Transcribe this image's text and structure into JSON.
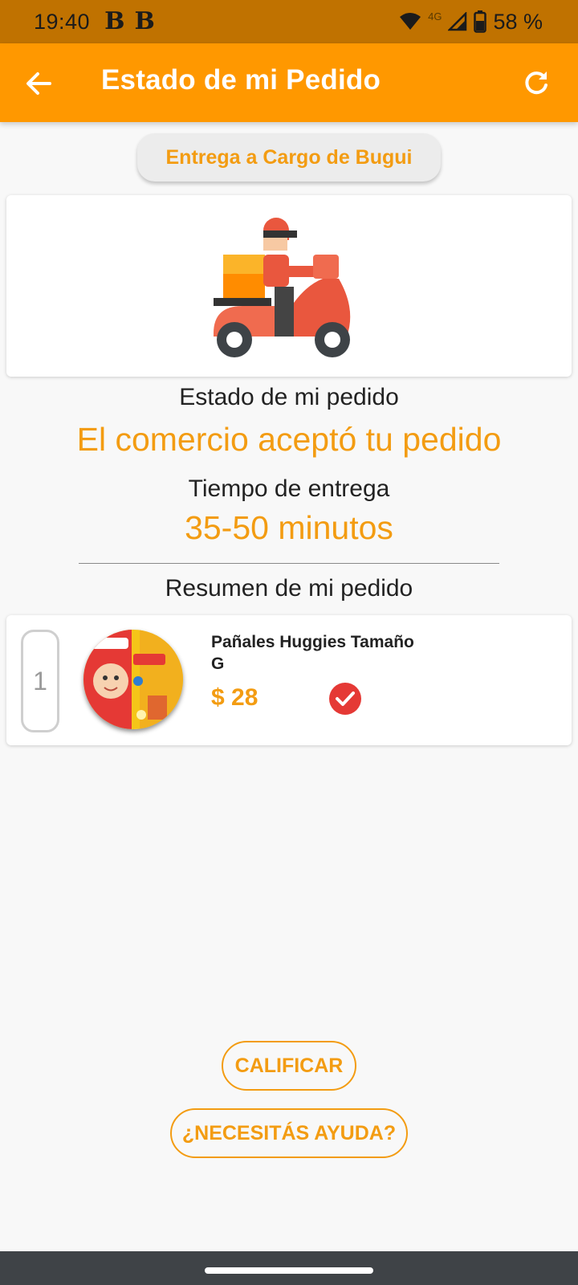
{
  "status_bar": {
    "time": "19:40",
    "app_icons": [
      "B",
      "B"
    ],
    "network": "4G",
    "battery": "58 %"
  },
  "app_bar": {
    "title": "Estado de mi Pedido",
    "back_icon": "arrow-left-icon",
    "refresh_icon": "refresh-icon"
  },
  "delivery": {
    "label": "Entrega a Cargo de Bugui"
  },
  "order_status": {
    "label": "Estado de mi pedido",
    "value": "El comercio aceptó tu pedido"
  },
  "delivery_time": {
    "label": "Tiempo de entrega",
    "value": "35-50 minutos"
  },
  "summary": {
    "title": "Resumen de mi pedido",
    "items": [
      {
        "quantity": "1",
        "name": "Pañales Huggies Tamaño G",
        "price": "$ 28",
        "checked": true
      }
    ]
  },
  "actions": {
    "rate": "CALIFICAR",
    "help": "¿NECESITÁS AYUDA?"
  },
  "colors": {
    "primary": "#ff9800",
    "status_bar": "#c07200",
    "accent_text": "#f39c12",
    "check": "#e53935"
  }
}
